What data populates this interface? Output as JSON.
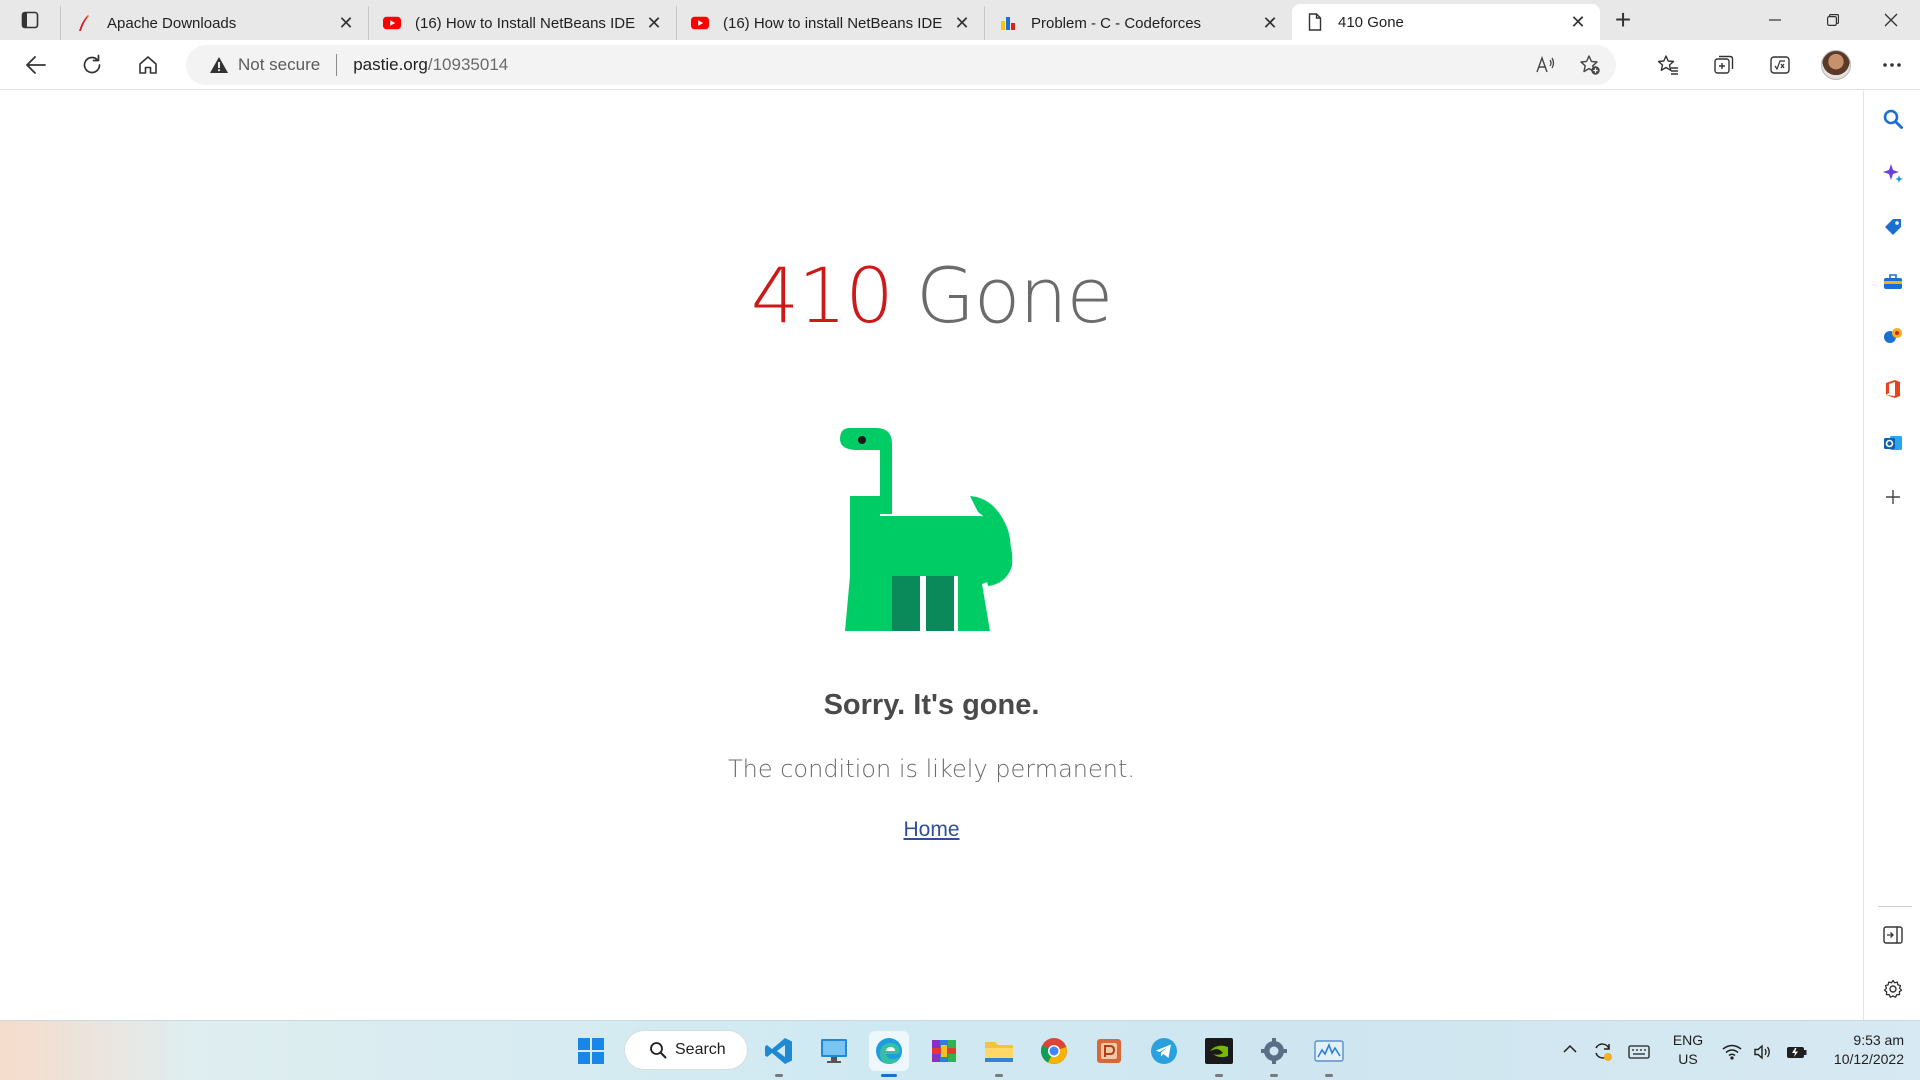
{
  "browser": {
    "tabs": [
      {
        "title": "Apache Downloads",
        "favicon": "apache-feather-icon",
        "active": false
      },
      {
        "title": "(16) How to Install NetBeans IDE",
        "favicon": "youtube-icon",
        "active": false
      },
      {
        "title": "(16) How to install NetBeans IDE",
        "favicon": "youtube-icon",
        "active": false
      },
      {
        "title": "Problem - C - Codeforces",
        "favicon": "codeforces-icon",
        "active": false
      },
      {
        "title": "410 Gone",
        "favicon": "page-icon",
        "active": true
      }
    ],
    "address": {
      "security_label": "Not secure",
      "host": "pastie.org",
      "path": "/10935014"
    }
  },
  "page": {
    "status_code": "410",
    "status_word": "Gone",
    "heading": "Sorry. It's gone.",
    "message": "The condition is likely permanent.",
    "home_link": "Home",
    "colors": {
      "code": "#cc1a1a",
      "dino": "#00cc66",
      "dino_legs": "#0a8a5a"
    }
  },
  "taskbar": {
    "search_label": "Search",
    "language_line1": "ENG",
    "language_line2": "US",
    "time": "9:53 am",
    "date": "10/12/2022"
  }
}
